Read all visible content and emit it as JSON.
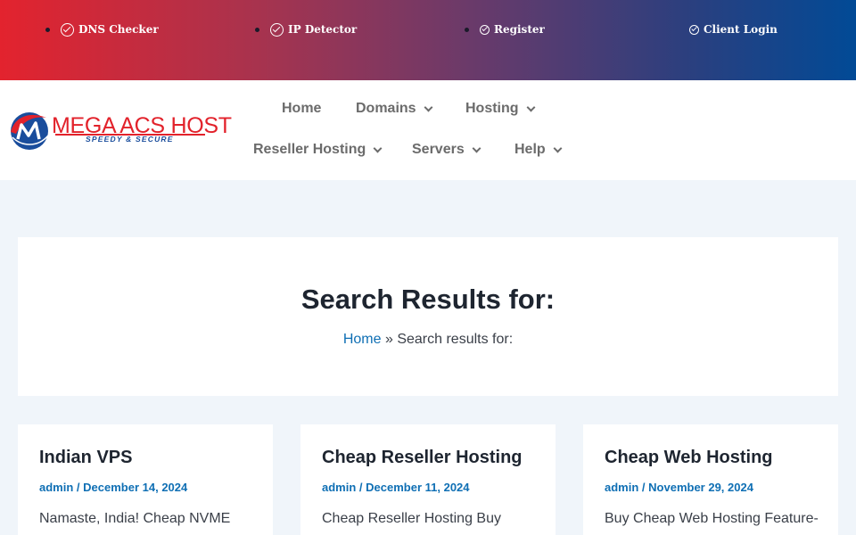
{
  "topbar": {
    "items": [
      {
        "label": "DNS Checker",
        "icon": "check-circle-icon"
      },
      {
        "label": "IP Detector",
        "icon": "check-circle-icon"
      },
      {
        "label": "Register",
        "icon": "check-circle-icon"
      },
      {
        "label": "Client Login",
        "icon": "check-circle-icon"
      }
    ],
    "colors": {
      "start": "#e3232e",
      "end": "#014a96"
    }
  },
  "header": {
    "logo": {
      "name": "MEGA ACS HOST",
      "tagline": "SPEEDY & SECURE",
      "colors": {
        "red": "#e2222b",
        "blue": "#1a4d9c"
      }
    },
    "nav": [
      {
        "label": "Home",
        "has_dropdown": false
      },
      {
        "label": "Domains",
        "has_dropdown": true
      },
      {
        "label": "Hosting",
        "has_dropdown": true
      },
      {
        "label": "Reseller Hosting",
        "has_dropdown": true
      },
      {
        "label": "Servers",
        "has_dropdown": true
      },
      {
        "label": "Help",
        "has_dropdown": true
      }
    ]
  },
  "search": {
    "title": "Search Results for:",
    "breadcrumb": {
      "home": "Home",
      "separator": "»",
      "current": "Search results for:"
    }
  },
  "posts": [
    {
      "title": "Indian VPS",
      "author": "admin",
      "date": "December 14, 2024",
      "excerpt": "Namaste, India! Cheap NVME"
    },
    {
      "title": "Cheap Reseller Hosting",
      "author": "admin",
      "date": "December 11, 2024",
      "excerpt": "Cheap Reseller Hosting Buy"
    },
    {
      "title": "Cheap Web Hosting",
      "author": "admin",
      "date": "November 29, 2024",
      "excerpt": "Buy Cheap Web Hosting Feature-"
    }
  ],
  "theme": {
    "accent": "#0f6fb4",
    "page_bg": "#f0f5fa"
  }
}
